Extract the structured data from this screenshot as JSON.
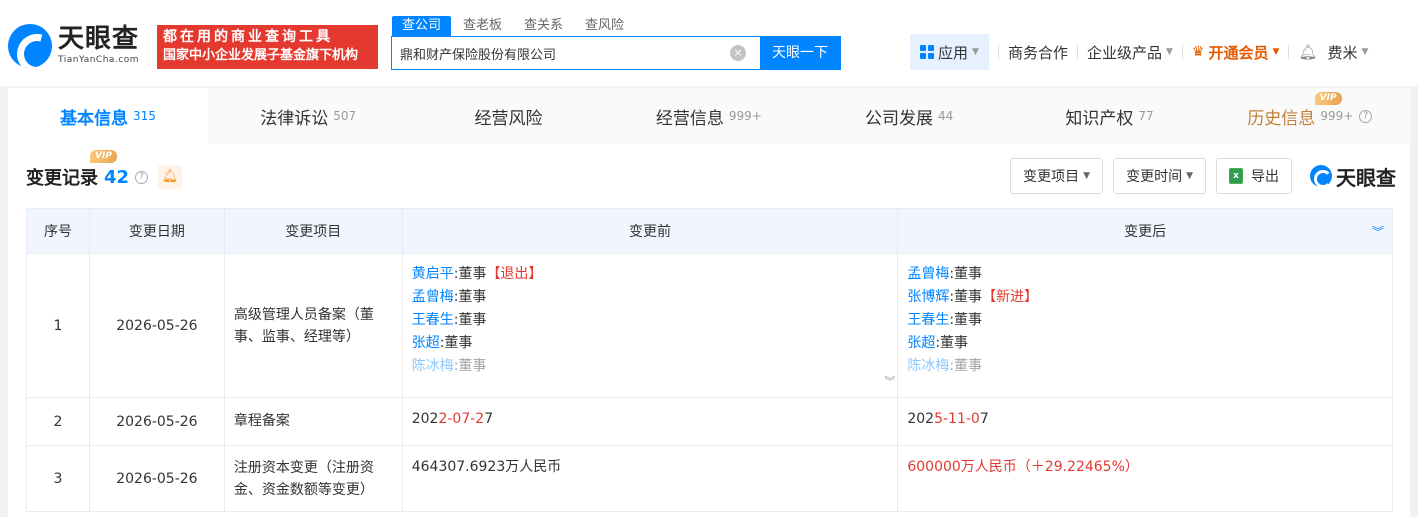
{
  "header": {
    "logo_cn": "天眼查",
    "logo_en": "TianYanCha.com",
    "slogan_line1": "都在用的商业查询工具",
    "slogan_line2": "国家中小企业发展子基金旗下机构",
    "search_tabs": [
      "查公司",
      "查老板",
      "查关系",
      "查风险"
    ],
    "search_value": "鼎和财产保险股份有限公司",
    "search_button": "天眼一下",
    "clear_icon": "×",
    "nav": {
      "app": "应用",
      "business": "商务合作",
      "enterprise": "企业级产品",
      "vip": "开通会员",
      "user": "费米"
    }
  },
  "tabs": [
    {
      "label": "基本信息",
      "count": "315"
    },
    {
      "label": "法律诉讼",
      "count": "507"
    },
    {
      "label": "经营风险",
      "count": ""
    },
    {
      "label": "经营信息",
      "count": "999+"
    },
    {
      "label": "公司发展",
      "count": "44"
    },
    {
      "label": "知识产权",
      "count": "77"
    },
    {
      "label": "历史信息",
      "count": "999+"
    }
  ],
  "vip_tag": "VIP",
  "section": {
    "title": "变更记录",
    "count": "42",
    "help": "?",
    "buttons": {
      "project": "变更项目",
      "time": "变更时间",
      "export": "导出"
    },
    "brand": "天眼查"
  },
  "table": {
    "headers": [
      "序号",
      "变更日期",
      "变更项目",
      "变更前",
      "变更后"
    ],
    "rows": [
      {
        "index": "1",
        "date": "2026-05-26",
        "item": "高级管理人员备案（董事、监事、经理等）",
        "before": [
          {
            "name": "黄启平",
            "role": ":董事",
            "tag": "【退出】"
          },
          {
            "name": "孟曾梅",
            "role": ":董事",
            "tag": ""
          },
          {
            "name": "王春生",
            "role": ":董事",
            "tag": ""
          },
          {
            "name": "张超",
            "role": ":董事",
            "tag": ""
          },
          {
            "name": "陈冰梅",
            "role": ":董事",
            "tag": ""
          }
        ],
        "after": [
          {
            "name": "孟曾梅",
            "role": ":董事",
            "tag": ""
          },
          {
            "name": "张博辉",
            "role": ":董事",
            "tag": "【新进】"
          },
          {
            "name": "王春生",
            "role": ":董事",
            "tag": ""
          },
          {
            "name": "张超",
            "role": ":董事",
            "tag": ""
          },
          {
            "name": "陈冰梅",
            "role": ":董事",
            "tag": ""
          }
        ]
      },
      {
        "index": "2",
        "date": "2026-05-26",
        "item": "章程备案",
        "before": {
          "prefix": "202",
          "changed": "2-07-2",
          "suffix": "7"
        },
        "after": {
          "prefix": "202",
          "changed": "5-11-0",
          "suffix": "7"
        }
      },
      {
        "index": "3",
        "date": "2026-05-26",
        "item": "注册资本变更（注册资金、资金数额等变更）",
        "before": "464307.6923万人民币",
        "after": "600000万人民币（＋29.22465%）"
      }
    ]
  },
  "colors": {
    "accent": "#0084ff",
    "alert": "#e4392f",
    "vip": "#e55a00"
  }
}
